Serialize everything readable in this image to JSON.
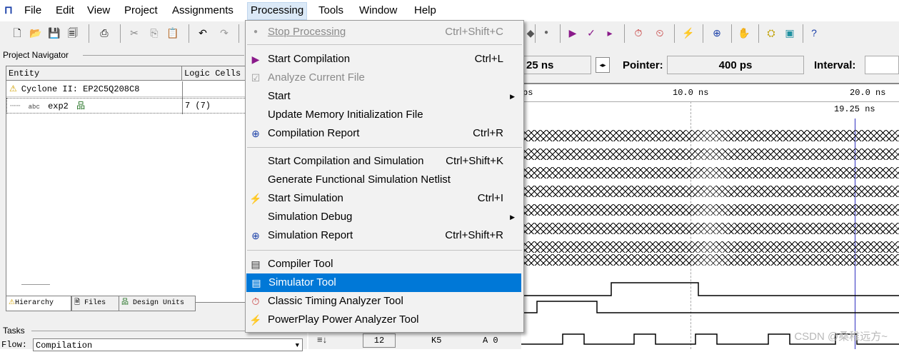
{
  "menubar": {
    "items": [
      "File",
      "Edit",
      "View",
      "Project",
      "Assignments",
      "Processing",
      "Tools",
      "Window",
      "Help"
    ],
    "open_item": "Processing"
  },
  "project_navigator": {
    "title": "Project Navigator",
    "columns": [
      "Entity",
      "Logic Cells"
    ],
    "rows": [
      {
        "entity": "Cyclone II: EP2C5Q208C8",
        "cells": ""
      },
      {
        "entity": "exp2",
        "cells": "7 (7)"
      }
    ],
    "tabs": [
      "Hierarchy",
      "Files",
      "Design Units"
    ]
  },
  "tasks": {
    "title": "Tasks",
    "flow_label": "Flow:",
    "flow_value": "Compilation"
  },
  "bottom_toolbar": {
    "count": "12",
    "pin": "K5",
    "value": "A 0"
  },
  "waveform": {
    "master_time": "25 ns",
    "pointer_label": "Pointer:",
    "pointer_value": "400 ps",
    "interval_label": "Interval:",
    "scale_left": "ps",
    "scale_mid": "10.0 ns",
    "scale_right": "20.0 ns",
    "cursor_time": "19.25 ns"
  },
  "processing_menu": {
    "items": [
      {
        "label": "Stop Processing",
        "shortcut": "Ctrl+Shift+C",
        "disabled": true,
        "icon": "stop-icon"
      },
      {
        "label": "Start Compilation",
        "shortcut": "Ctrl+L",
        "icon": "play-icon"
      },
      {
        "label": "Analyze Current File",
        "shortcut": "",
        "disabled": true,
        "icon": "analyze-icon"
      },
      {
        "label": "Start",
        "shortcut": "",
        "submenu": true
      },
      {
        "label": "Update Memory Initialization File",
        "shortcut": ""
      },
      {
        "label": "Compilation Report",
        "shortcut": "Ctrl+R",
        "icon": "report-icon"
      },
      {
        "label": "Start Compilation and Simulation",
        "shortcut": "Ctrl+Shift+K"
      },
      {
        "label": "Generate Functional Simulation Netlist",
        "shortcut": ""
      },
      {
        "label": "Start Simulation",
        "shortcut": "Ctrl+I",
        "icon": "simulation-icon"
      },
      {
        "label": "Simulation Debug",
        "shortcut": "",
        "submenu": true
      },
      {
        "label": "Simulation Report",
        "shortcut": "Ctrl+Shift+R",
        "icon": "sim-report-icon"
      },
      {
        "label": "Compiler Tool",
        "shortcut": "",
        "icon": "compiler-tool-icon"
      },
      {
        "label": "Simulator Tool",
        "shortcut": "",
        "highlighted": true,
        "icon": "simulator-tool-icon"
      },
      {
        "label": "Classic Timing Analyzer Tool",
        "shortcut": "",
        "icon": "timing-icon"
      },
      {
        "label": "PowerPlay Power Analyzer Tool",
        "shortcut": "",
        "icon": "power-icon"
      }
    ]
  },
  "watermark": "CSDN @桑稚远方~",
  "colors": {
    "highlight": "#0078d7",
    "cursor": "#3030c0",
    "menu_bg": "#f2f2f2"
  }
}
